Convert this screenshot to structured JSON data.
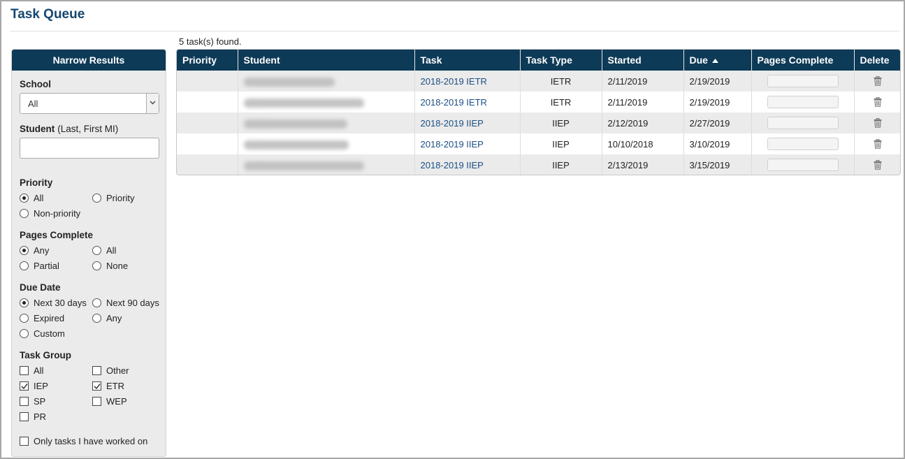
{
  "page": {
    "title": "Task Queue",
    "found_text": "5 task(s) found."
  },
  "sidebar": {
    "header": "Narrow Results",
    "school": {
      "label": "School",
      "selected": "All"
    },
    "student": {
      "label": "Student",
      "hint": "(Last, First MI)",
      "value": ""
    },
    "priority": {
      "label": "Priority",
      "options": [
        "All",
        "Priority",
        "Non-priority"
      ],
      "selected": "All"
    },
    "pages_complete": {
      "label": "Pages Complete",
      "options": [
        "Any",
        "All",
        "Partial",
        "None"
      ],
      "selected": "Any"
    },
    "due_date": {
      "label": "Due Date",
      "options": [
        "Next 30 days",
        "Next 90 days",
        "Expired",
        "Any",
        "Custom"
      ],
      "selected": "Next 30 days"
    },
    "task_group": {
      "label": "Task Group",
      "options": [
        "All",
        "Other",
        "IEP",
        "ETR",
        "SP",
        "WEP",
        "PR"
      ],
      "checked": [
        "IEP",
        "ETR"
      ]
    },
    "only_mine": {
      "label": "Only tasks I have worked on",
      "checked": false
    }
  },
  "table": {
    "columns": [
      "Priority",
      "Student",
      "Task",
      "Task Type",
      "Started",
      "Due",
      "Pages Complete",
      "Delete"
    ],
    "sorted_column": "Due",
    "sort_direction": "ascending",
    "rows": [
      {
        "priority": "",
        "task": "2018-2019 IETR",
        "task_type": "IETR",
        "started": "2/11/2019",
        "due": "2/19/2019"
      },
      {
        "priority": "",
        "task": "2018-2019 IETR",
        "task_type": "IETR",
        "started": "2/11/2019",
        "due": "2/19/2019"
      },
      {
        "priority": "",
        "task": "2018-2019 IIEP",
        "task_type": "IIEP",
        "started": "2/12/2019",
        "due": "2/27/2019"
      },
      {
        "priority": "",
        "task": "2018-2019 IIEP",
        "task_type": "IIEP",
        "started": "10/10/2018",
        "due": "3/10/2019"
      },
      {
        "priority": "",
        "task": "2018-2019 IIEP",
        "task_type": "IIEP",
        "started": "2/13/2019",
        "due": "3/15/2019"
      }
    ]
  },
  "colors": {
    "header_bg": "#0d3a57",
    "title": "#16466f",
    "link": "#1b4f83",
    "sidebar_bg": "#ebebeb"
  },
  "icons": {
    "sort": "triangle-up-icon",
    "delete": "trash-icon",
    "dropdown": "chevron-down-icon"
  }
}
